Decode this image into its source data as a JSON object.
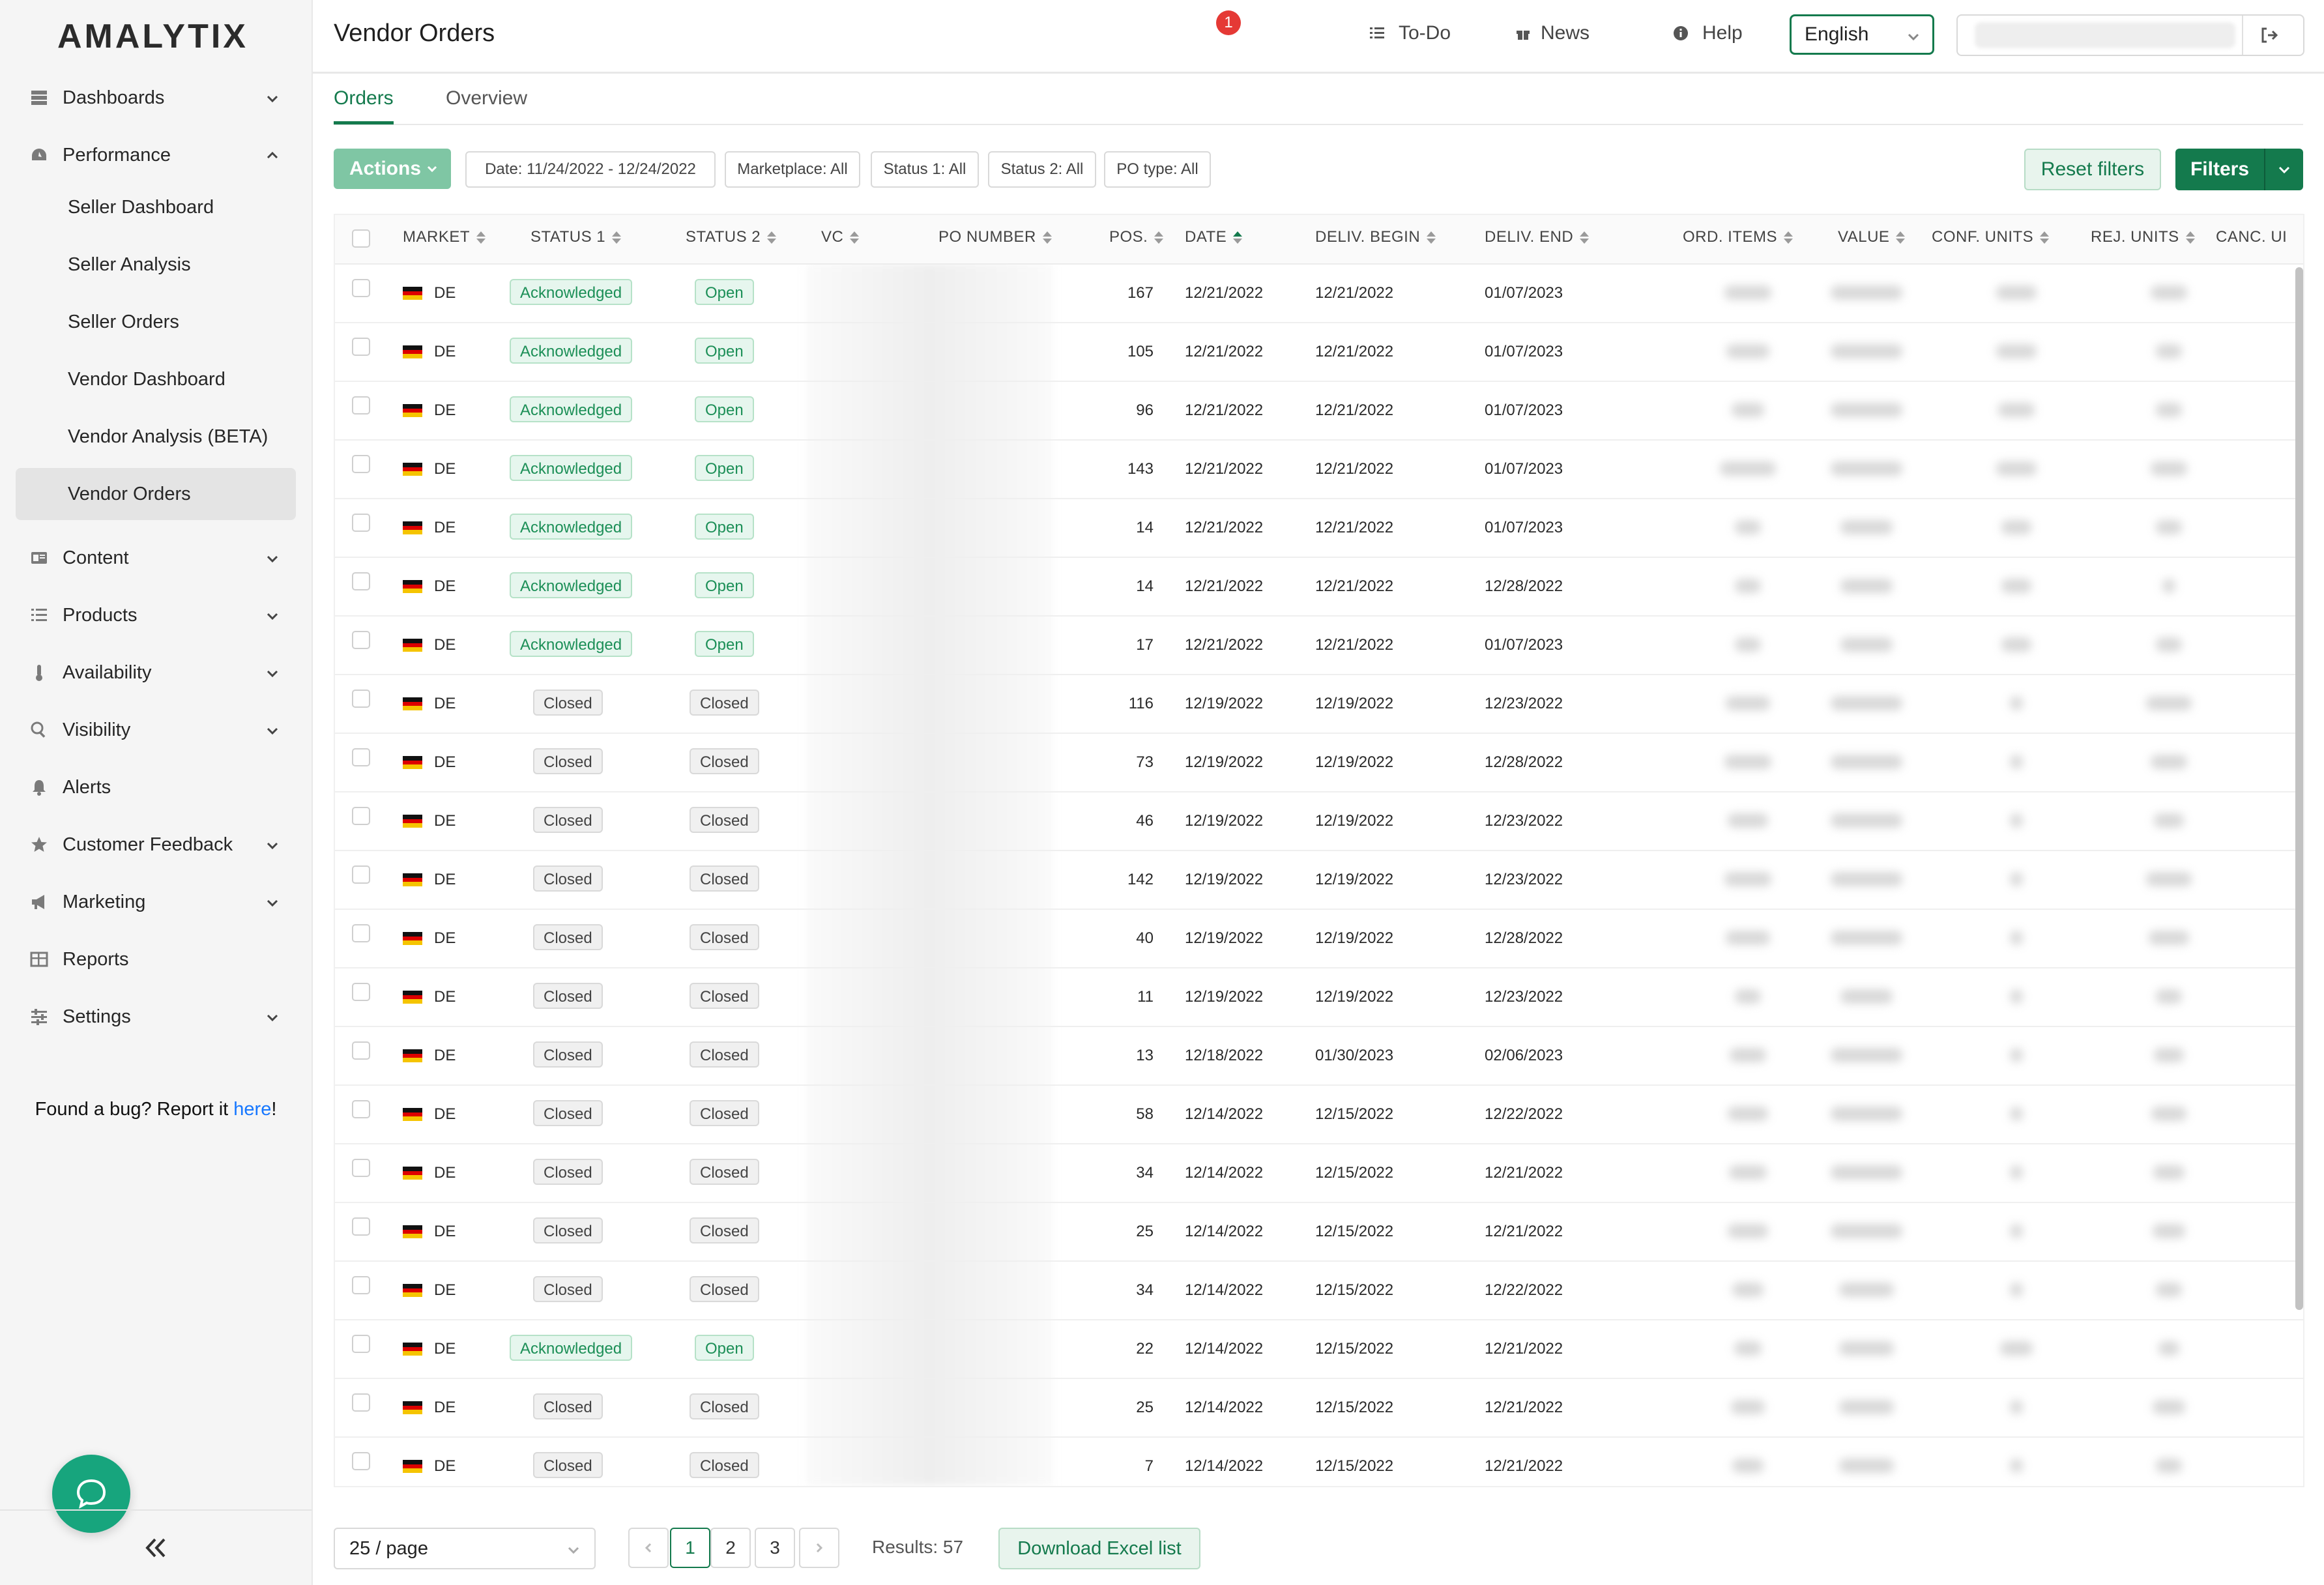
{
  "app": {
    "logo": "AMALYTIX"
  },
  "sidebar": {
    "items": [
      {
        "label": "Dashboards",
        "icon": "dashboard-icon",
        "expandable": true,
        "expanded": false
      },
      {
        "label": "Performance",
        "icon": "gauge-icon",
        "expandable": true,
        "expanded": true,
        "children": [
          {
            "label": "Seller Dashboard"
          },
          {
            "label": "Seller Analysis"
          },
          {
            "label": "Seller Orders"
          },
          {
            "label": "Vendor Dashboard"
          },
          {
            "label": "Vendor Analysis (BETA)"
          },
          {
            "label": "Vendor Orders",
            "active": true
          }
        ]
      },
      {
        "label": "Content",
        "icon": "content-icon",
        "expandable": true,
        "expanded": false
      },
      {
        "label": "Products",
        "icon": "list-icon",
        "expandable": true,
        "expanded": false
      },
      {
        "label": "Availability",
        "icon": "thermometer-icon",
        "expandable": true,
        "expanded": false
      },
      {
        "label": "Visibility",
        "icon": "search-icon",
        "expandable": true,
        "expanded": false
      },
      {
        "label": "Alerts",
        "icon": "bell-icon",
        "expandable": false
      },
      {
        "label": "Customer Feedback",
        "icon": "star-icon",
        "expandable": true,
        "expanded": false
      },
      {
        "label": "Marketing",
        "icon": "megaphone-icon",
        "expandable": true,
        "expanded": false
      },
      {
        "label": "Reports",
        "icon": "table-icon",
        "expandable": false
      },
      {
        "label": "Settings",
        "icon": "sliders-icon",
        "expandable": true,
        "expanded": false
      }
    ],
    "bug_text": "Found a bug? Report it ",
    "bug_link": "here",
    "bug_suffix": "!"
  },
  "header": {
    "title": "Vendor Orders",
    "todo_label": "To-Do",
    "news_label": "News",
    "news_count": "1",
    "help_label": "Help",
    "language": "English"
  },
  "tabs": [
    {
      "label": "Orders",
      "active": true
    },
    {
      "label": "Overview",
      "active": false
    }
  ],
  "filters": {
    "actions_label": "Actions",
    "chips": [
      "Date: 11/24/2022 - 12/24/2022",
      "Marketplace: All",
      "Status 1: All",
      "Status 2: All",
      "PO type: All"
    ],
    "reset_label": "Reset filters",
    "filters_label": "Filters"
  },
  "table": {
    "columns": [
      "MARKET",
      "STATUS 1",
      "STATUS 2",
      "VC",
      "PO NUMBER",
      "POS.",
      "DATE",
      "DELIV. BEGIN",
      "DELIV. END",
      "ORD. ITEMS",
      "VALUE",
      "CONF. UNITS",
      "REJ. UNITS",
      "CANC. UI"
    ],
    "sorted_column": "DATE",
    "rows": [
      {
        "market": "DE",
        "status1": "Acknowledged",
        "status2": "Open",
        "pos": "167",
        "date": "12/21/2022",
        "deliv_begin": "12/21/2022",
        "deliv_end": "01/07/2023"
      },
      {
        "market": "DE",
        "status1": "Acknowledged",
        "status2": "Open",
        "pos": "105",
        "date": "12/21/2022",
        "deliv_begin": "12/21/2022",
        "deliv_end": "01/07/2023"
      },
      {
        "market": "DE",
        "status1": "Acknowledged",
        "status2": "Open",
        "pos": "96",
        "date": "12/21/2022",
        "deliv_begin": "12/21/2022",
        "deliv_end": "01/07/2023"
      },
      {
        "market": "DE",
        "status1": "Acknowledged",
        "status2": "Open",
        "pos": "143",
        "date": "12/21/2022",
        "deliv_begin": "12/21/2022",
        "deliv_end": "01/07/2023"
      },
      {
        "market": "DE",
        "status1": "Acknowledged",
        "status2": "Open",
        "pos": "14",
        "date": "12/21/2022",
        "deliv_begin": "12/21/2022",
        "deliv_end": "01/07/2023"
      },
      {
        "market": "DE",
        "status1": "Acknowledged",
        "status2": "Open",
        "pos": "14",
        "date": "12/21/2022",
        "deliv_begin": "12/21/2022",
        "deliv_end": "12/28/2022"
      },
      {
        "market": "DE",
        "status1": "Acknowledged",
        "status2": "Open",
        "pos": "17",
        "date": "12/21/2022",
        "deliv_begin": "12/21/2022",
        "deliv_end": "01/07/2023"
      },
      {
        "market": "DE",
        "status1": "Closed",
        "status2": "Closed",
        "pos": "116",
        "date": "12/19/2022",
        "deliv_begin": "12/19/2022",
        "deliv_end": "12/23/2022"
      },
      {
        "market": "DE",
        "status1": "Closed",
        "status2": "Closed",
        "pos": "73",
        "date": "12/19/2022",
        "deliv_begin": "12/19/2022",
        "deliv_end": "12/28/2022"
      },
      {
        "market": "DE",
        "status1": "Closed",
        "status2": "Closed",
        "pos": "46",
        "date": "12/19/2022",
        "deliv_begin": "12/19/2022",
        "deliv_end": "12/23/2022"
      },
      {
        "market": "DE",
        "status1": "Closed",
        "status2": "Closed",
        "pos": "142",
        "date": "12/19/2022",
        "deliv_begin": "12/19/2022",
        "deliv_end": "12/23/2022"
      },
      {
        "market": "DE",
        "status1": "Closed",
        "status2": "Closed",
        "pos": "40",
        "date": "12/19/2022",
        "deliv_begin": "12/19/2022",
        "deliv_end": "12/28/2022"
      },
      {
        "market": "DE",
        "status1": "Closed",
        "status2": "Closed",
        "pos": "11",
        "date": "12/19/2022",
        "deliv_begin": "12/19/2022",
        "deliv_end": "12/23/2022"
      },
      {
        "market": "DE",
        "status1": "Closed",
        "status2": "Closed",
        "pos": "13",
        "date": "12/18/2022",
        "deliv_begin": "01/30/2023",
        "deliv_end": "02/06/2023"
      },
      {
        "market": "DE",
        "status1": "Closed",
        "status2": "Closed",
        "pos": "58",
        "date": "12/14/2022",
        "deliv_begin": "12/15/2022",
        "deliv_end": "12/22/2022"
      },
      {
        "market": "DE",
        "status1": "Closed",
        "status2": "Closed",
        "pos": "34",
        "date": "12/14/2022",
        "deliv_begin": "12/15/2022",
        "deliv_end": "12/21/2022"
      },
      {
        "market": "DE",
        "status1": "Closed",
        "status2": "Closed",
        "pos": "25",
        "date": "12/14/2022",
        "deliv_begin": "12/15/2022",
        "deliv_end": "12/21/2022"
      },
      {
        "market": "DE",
        "status1": "Closed",
        "status2": "Closed",
        "pos": "34",
        "date": "12/14/2022",
        "deliv_begin": "12/15/2022",
        "deliv_end": "12/22/2022"
      },
      {
        "market": "DE",
        "status1": "Acknowledged",
        "status2": "Open",
        "pos": "22",
        "date": "12/14/2022",
        "deliv_begin": "12/15/2022",
        "deliv_end": "12/21/2022"
      },
      {
        "market": "DE",
        "status1": "Closed",
        "status2": "Closed",
        "pos": "25",
        "date": "12/14/2022",
        "deliv_begin": "12/15/2022",
        "deliv_end": "12/21/2022"
      },
      {
        "market": "DE",
        "status1": "Closed",
        "status2": "Closed",
        "pos": "7",
        "date": "12/14/2022",
        "deliv_begin": "12/15/2022",
        "deliv_end": "12/21/2022"
      }
    ]
  },
  "pagination": {
    "page_size": "25 / page",
    "pages": [
      "1",
      "2",
      "3"
    ],
    "current_page": "1",
    "results": "Results: 57",
    "download_label": "Download Excel list"
  },
  "colors": {
    "brand": "#147a4d",
    "ack_text": "#1c8f57",
    "chat": "#17a57d"
  }
}
